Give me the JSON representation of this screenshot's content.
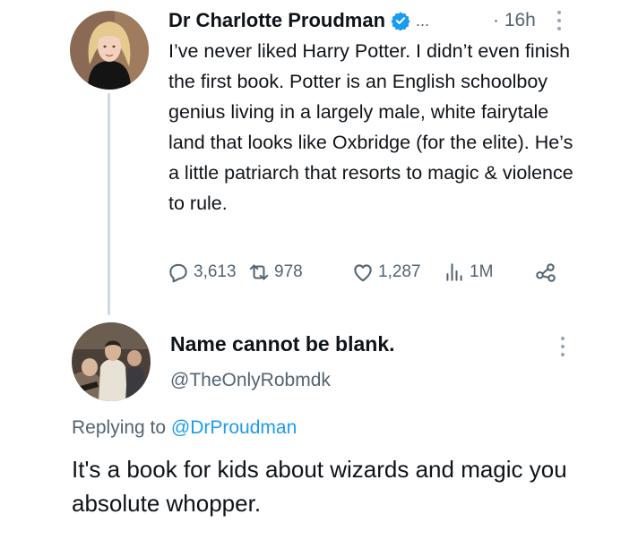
{
  "tweet": {
    "author_name": "Dr Charlotte Proudman",
    "verified_icon": "verified-badge-icon",
    "ellipsis": "...",
    "time": "· 16h",
    "text": "I’ve never liked Harry Potter. I didn’t even finish the first book. Potter is an English schoolboy genius living in a largely male, white fairytale land that looks like Oxbridge (for the elite). He’s a little patriarch that resorts to magic & violence to rule.",
    "stats": {
      "replies": "3,613",
      "reposts": "978",
      "likes": "1,287",
      "views": "1M"
    }
  },
  "reply": {
    "author_name": "Name cannot be blank.",
    "handle": "@TheOnlyRobmdk",
    "replying_prefix": "Replying to",
    "replying_to": "@DrProudman",
    "text": "It's a book for kids about wizards and magic you absolute whopper."
  },
  "colors": {
    "accent": "#1d9bf0",
    "secondary_text": "#536471",
    "primary_text": "#0f1419",
    "thread_line": "#cfd9de"
  }
}
